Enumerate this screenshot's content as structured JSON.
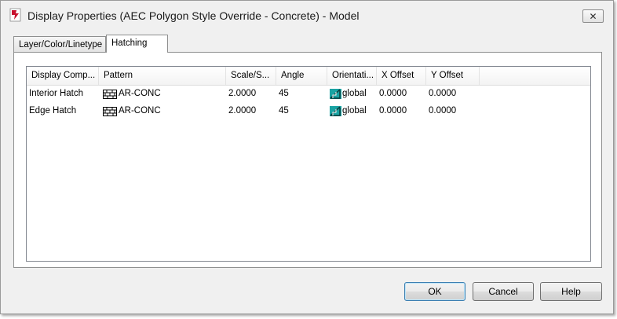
{
  "window": {
    "title": "Display Properties (AEC Polygon Style Override - Concrete) - Model",
    "close_label": "✕"
  },
  "tabs": [
    {
      "label": "Layer/Color/Linetype",
      "selected": false
    },
    {
      "label": "Hatching",
      "selected": true
    }
  ],
  "list": {
    "columns": [
      "Display Comp...",
      "Pattern",
      "Scale/S...",
      "Angle",
      "Orientati...",
      "X Offset",
      "Y Offset"
    ],
    "rows": [
      {
        "display_component": "Interior Hatch",
        "pattern": "AR-CONC",
        "scale": "2.0000",
        "angle": "45",
        "orientation": "global",
        "x_offset": "0.0000",
        "y_offset": "0.0000"
      },
      {
        "display_component": "Edge Hatch",
        "pattern": "AR-CONC",
        "scale": "2.0000",
        "angle": "45",
        "orientation": "global",
        "x_offset": "0.0000",
        "y_offset": "0.0000"
      }
    ]
  },
  "buttons": {
    "ok": "OK",
    "cancel": "Cancel",
    "help": "Help"
  },
  "icons": {
    "app": "autocad-app-icon",
    "pattern": "hatch-pattern-icon",
    "orientation": "orientation-global-icon"
  },
  "colors": {
    "orientation_icon": "#1aa3a3",
    "default_button_border": "#3c7fb1"
  }
}
